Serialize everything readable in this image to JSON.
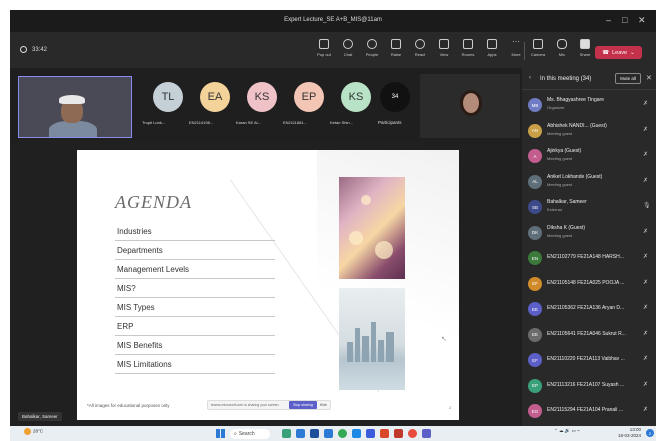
{
  "window": {
    "title": "Expert Lecture_SE A+B_MIS@11am",
    "minimize_glyph": "–",
    "maximize_glyph": "□",
    "close_glyph": "✕"
  },
  "toolbar": {
    "timer": "33:42",
    "buttons": [
      {
        "label": "Pop out",
        "icon": "pop-out-icon"
      },
      {
        "label": "Chat",
        "icon": "chat-icon"
      },
      {
        "label": "People",
        "icon": "people-icon"
      },
      {
        "label": "Raise",
        "icon": "raise-hand-icon"
      },
      {
        "label": "React",
        "icon": "react-icon"
      },
      {
        "label": "View",
        "icon": "view-icon"
      },
      {
        "label": "Rooms",
        "icon": "rooms-icon"
      },
      {
        "label": "Apps",
        "icon": "apps-icon"
      },
      {
        "label": "More",
        "icon": "more-icon"
      },
      {
        "label": "Camera",
        "icon": "camera-icon"
      },
      {
        "label": "Mic",
        "icon": "mic-off-icon"
      },
      {
        "label": "Share",
        "icon": "share-icon"
      }
    ],
    "leave_label": "Leave"
  },
  "strip": {
    "participants": [
      {
        "initials": "TL",
        "name": "Trupti Lonk...",
        "color": "#c5cfd6"
      },
      {
        "initials": "EA",
        "name": "EN2114198...",
        "color": "#f3d39a"
      },
      {
        "initials": "KS",
        "name": "Karan SE Al...",
        "color": "#efc2c8"
      },
      {
        "initials": "EP",
        "name": "EN2111681...",
        "color": "#f2c5b4"
      },
      {
        "initials": "KS",
        "name": "Ketan Shin...",
        "color": "#b9e3c6"
      }
    ],
    "count": "34",
    "count_label": "Participants"
  },
  "slide": {
    "title": "AGENDA",
    "items": [
      "Industries",
      "Departments",
      "Management Levels",
      "MIS?",
      "MIS Types",
      "ERP",
      "MIS Benefits",
      "MIS Limitations"
    ],
    "footnote": "*All images for educational purposes only",
    "share_notice": "teams.microsoft.com is sharing your screen.",
    "stop_sharing": "Stop sharing",
    "hide": "Hide",
    "page_number": "2"
  },
  "presenter_tag": "Bahalkar, Sameer",
  "panel": {
    "title": "In this meeting (34)",
    "mute_all": "Mute all",
    "people": [
      {
        "initials": "MB",
        "name": "Ms. Bhagyashree Tingare",
        "sub": "Organizer",
        "color": "#6f7cc4"
      },
      {
        "initials": "AN",
        "name": "Abhishek NANDI... (Guest)",
        "sub": "Meeting guest",
        "color": "#c9a047"
      },
      {
        "initials": "A",
        "name": "Ajinkya (Guest)",
        "sub": "Meeting guest",
        "color": "#c25d8e"
      },
      {
        "initials": "AL",
        "name": "Aniket Lokhande (Guest)",
        "sub": "Meeting guest",
        "color": "#5f6f7a"
      },
      {
        "initials": "SB",
        "name": "Bahalkar, Sameer",
        "sub": "External",
        "color": "#3d4a8a"
      },
      {
        "initials": "DK",
        "name": "Diksha K (Guest)",
        "sub": "Meeting guest",
        "color": "#5f6f7a"
      },
      {
        "initials": "EN",
        "name": "EN21102779 FE21A148 HARSH...",
        "sub": "",
        "color": "#3b7a3b"
      },
      {
        "initials": "EF",
        "name": "EN21105148 FE21A025 POOJA ...",
        "sub": "",
        "color": "#d08a2a"
      },
      {
        "initials": "EE",
        "name": "EN21105362 FE21A136 Aryan D...",
        "sub": "",
        "color": "#5b5fc7"
      },
      {
        "initials": "EE",
        "name": "EN21105641 FE21A046 Sukrut R...",
        "sub": "",
        "color": "#6b6b6b"
      },
      {
        "initials": "EF",
        "name": "EN21110220 FE21A113 Vaibhav ...",
        "sub": "",
        "color": "#5b5fc7"
      },
      {
        "initials": "EP",
        "name": "EN21113216 FE21A107 Suyash ...",
        "sub": "",
        "color": "#3aa07a"
      },
      {
        "initials": "EG",
        "name": "EN21115294 FE21A104 Pranali ...",
        "sub": "",
        "color": "#c25d8e"
      }
    ]
  },
  "taskbar": {
    "weather_temp": "28°C",
    "weather_desc": "Sunny",
    "search_label": "Search",
    "lang": "ENG\nIN",
    "time": "13:00",
    "date": "18-03-2024",
    "notif_count": "2"
  }
}
